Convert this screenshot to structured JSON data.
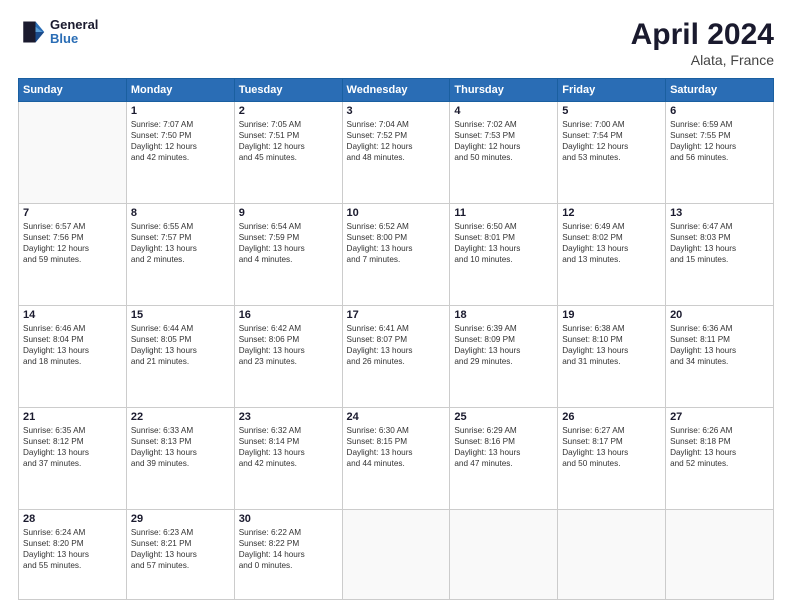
{
  "header": {
    "logo_line1": "General",
    "logo_line2": "Blue",
    "title": "April 2024",
    "subtitle": "Alata, France"
  },
  "weekdays": [
    "Sunday",
    "Monday",
    "Tuesday",
    "Wednesday",
    "Thursday",
    "Friday",
    "Saturday"
  ],
  "weeks": [
    [
      {
        "day": "",
        "info": ""
      },
      {
        "day": "1",
        "info": "Sunrise: 7:07 AM\nSunset: 7:50 PM\nDaylight: 12 hours\nand 42 minutes."
      },
      {
        "day": "2",
        "info": "Sunrise: 7:05 AM\nSunset: 7:51 PM\nDaylight: 12 hours\nand 45 minutes."
      },
      {
        "day": "3",
        "info": "Sunrise: 7:04 AM\nSunset: 7:52 PM\nDaylight: 12 hours\nand 48 minutes."
      },
      {
        "day": "4",
        "info": "Sunrise: 7:02 AM\nSunset: 7:53 PM\nDaylight: 12 hours\nand 50 minutes."
      },
      {
        "day": "5",
        "info": "Sunrise: 7:00 AM\nSunset: 7:54 PM\nDaylight: 12 hours\nand 53 minutes."
      },
      {
        "day": "6",
        "info": "Sunrise: 6:59 AM\nSunset: 7:55 PM\nDaylight: 12 hours\nand 56 minutes."
      }
    ],
    [
      {
        "day": "7",
        "info": "Sunrise: 6:57 AM\nSunset: 7:56 PM\nDaylight: 12 hours\nand 59 minutes."
      },
      {
        "day": "8",
        "info": "Sunrise: 6:55 AM\nSunset: 7:57 PM\nDaylight: 13 hours\nand 2 minutes."
      },
      {
        "day": "9",
        "info": "Sunrise: 6:54 AM\nSunset: 7:59 PM\nDaylight: 13 hours\nand 4 minutes."
      },
      {
        "day": "10",
        "info": "Sunrise: 6:52 AM\nSunset: 8:00 PM\nDaylight: 13 hours\nand 7 minutes."
      },
      {
        "day": "11",
        "info": "Sunrise: 6:50 AM\nSunset: 8:01 PM\nDaylight: 13 hours\nand 10 minutes."
      },
      {
        "day": "12",
        "info": "Sunrise: 6:49 AM\nSunset: 8:02 PM\nDaylight: 13 hours\nand 13 minutes."
      },
      {
        "day": "13",
        "info": "Sunrise: 6:47 AM\nSunset: 8:03 PM\nDaylight: 13 hours\nand 15 minutes."
      }
    ],
    [
      {
        "day": "14",
        "info": "Sunrise: 6:46 AM\nSunset: 8:04 PM\nDaylight: 13 hours\nand 18 minutes."
      },
      {
        "day": "15",
        "info": "Sunrise: 6:44 AM\nSunset: 8:05 PM\nDaylight: 13 hours\nand 21 minutes."
      },
      {
        "day": "16",
        "info": "Sunrise: 6:42 AM\nSunset: 8:06 PM\nDaylight: 13 hours\nand 23 minutes."
      },
      {
        "day": "17",
        "info": "Sunrise: 6:41 AM\nSunset: 8:07 PM\nDaylight: 13 hours\nand 26 minutes."
      },
      {
        "day": "18",
        "info": "Sunrise: 6:39 AM\nSunset: 8:09 PM\nDaylight: 13 hours\nand 29 minutes."
      },
      {
        "day": "19",
        "info": "Sunrise: 6:38 AM\nSunset: 8:10 PM\nDaylight: 13 hours\nand 31 minutes."
      },
      {
        "day": "20",
        "info": "Sunrise: 6:36 AM\nSunset: 8:11 PM\nDaylight: 13 hours\nand 34 minutes."
      }
    ],
    [
      {
        "day": "21",
        "info": "Sunrise: 6:35 AM\nSunset: 8:12 PM\nDaylight: 13 hours\nand 37 minutes."
      },
      {
        "day": "22",
        "info": "Sunrise: 6:33 AM\nSunset: 8:13 PM\nDaylight: 13 hours\nand 39 minutes."
      },
      {
        "day": "23",
        "info": "Sunrise: 6:32 AM\nSunset: 8:14 PM\nDaylight: 13 hours\nand 42 minutes."
      },
      {
        "day": "24",
        "info": "Sunrise: 6:30 AM\nSunset: 8:15 PM\nDaylight: 13 hours\nand 44 minutes."
      },
      {
        "day": "25",
        "info": "Sunrise: 6:29 AM\nSunset: 8:16 PM\nDaylight: 13 hours\nand 47 minutes."
      },
      {
        "day": "26",
        "info": "Sunrise: 6:27 AM\nSunset: 8:17 PM\nDaylight: 13 hours\nand 50 minutes."
      },
      {
        "day": "27",
        "info": "Sunrise: 6:26 AM\nSunset: 8:18 PM\nDaylight: 13 hours\nand 52 minutes."
      }
    ],
    [
      {
        "day": "28",
        "info": "Sunrise: 6:24 AM\nSunset: 8:20 PM\nDaylight: 13 hours\nand 55 minutes."
      },
      {
        "day": "29",
        "info": "Sunrise: 6:23 AM\nSunset: 8:21 PM\nDaylight: 13 hours\nand 57 minutes."
      },
      {
        "day": "30",
        "info": "Sunrise: 6:22 AM\nSunset: 8:22 PM\nDaylight: 14 hours\nand 0 minutes."
      },
      {
        "day": "",
        "info": ""
      },
      {
        "day": "",
        "info": ""
      },
      {
        "day": "",
        "info": ""
      },
      {
        "day": "",
        "info": ""
      }
    ]
  ]
}
